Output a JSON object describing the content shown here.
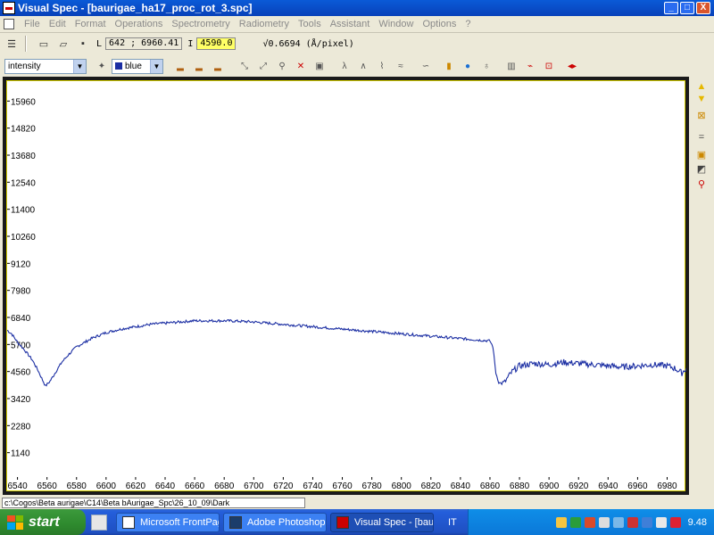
{
  "window": {
    "title": "Visual Spec - [baurigae_ha17_proc_rot_3.spc]",
    "min": "_",
    "max": "□",
    "close": "X"
  },
  "menu": [
    "File",
    "Edit",
    "Format",
    "Operations",
    "Spectrometry",
    "Radiometry",
    "Tools",
    "Assistant",
    "Window",
    "Options",
    "?"
  ],
  "toolbar1": {
    "l_label": "L",
    "coords": "642 ; 6960.41",
    "i_label": "I",
    "intensity": "4590.0",
    "dispersion": "√0.6694 (Å/pixel)"
  },
  "toolbar2": {
    "profile_select": "intensity",
    "color_select": "blue"
  },
  "status": {
    "path": "c:\\Cogos\\Beta aurigae\\C14\\Beta bAurigae_Spc\\26_10_09\\Dark"
  },
  "taskbar": {
    "start": "start",
    "tasks": [
      "Microsoft FrontPage -...",
      "Adobe Photoshop CS3",
      "Visual Spec - [bauriga..."
    ],
    "lang": "IT",
    "clock": "9.48"
  },
  "colors": {
    "plot_line": "#1b2ea3",
    "plot_bg": "#ffffff",
    "plot_border": "#d7d000"
  },
  "chart_data": {
    "type": "line",
    "x_ticks": [
      6540,
      6560,
      6580,
      6600,
      6620,
      6640,
      6660,
      6680,
      6700,
      6720,
      6740,
      6760,
      6780,
      6800,
      6820,
      6840,
      6860,
      6880,
      6900,
      6920,
      6940,
      6960,
      6980
    ],
    "y_ticks": [
      1140,
      2280,
      3420,
      4560,
      5700,
      6840,
      7980,
      9120,
      10260,
      11400,
      12540,
      13680,
      14820,
      15960
    ],
    "xlim": [
      6533,
      6993
    ],
    "ylim": [
      0,
      16800
    ],
    "series": [
      {
        "x": [
          6533,
          6536,
          6540,
          6545,
          6550,
          6554,
          6557,
          6559,
          6562,
          6566,
          6570,
          6575,
          6580,
          6590,
          6600,
          6610,
          6620,
          6630,
          6640,
          6650,
          6660,
          6670,
          6680,
          6690,
          6700,
          6710,
          6720,
          6730,
          6740,
          6750,
          6760,
          6770,
          6780,
          6790,
          6800,
          6810,
          6820,
          6830,
          6840,
          6850,
          6860,
          6862,
          6864,
          6866,
          6868,
          6870,
          6872,
          6875,
          6880,
          6890,
          6900,
          6910,
          6920,
          6930,
          6940,
          6950,
          6960,
          6970,
          6980,
          6985,
          6990,
          6993
        ],
        "y": [
          6300,
          6150,
          5800,
          5450,
          5050,
          4600,
          4200,
          3950,
          4150,
          4550,
          4950,
          5300,
          5600,
          5950,
          6200,
          6350,
          6450,
          6550,
          6600,
          6650,
          6700,
          6700,
          6700,
          6680,
          6650,
          6600,
          6550,
          6500,
          6450,
          6400,
          6350,
          6300,
          6250,
          6200,
          6150,
          6100,
          6050,
          6000,
          5950,
          5900,
          5850,
          5600,
          4500,
          4100,
          4050,
          4100,
          4300,
          4550,
          4800,
          4900,
          4850,
          4950,
          4900,
          4850,
          4800,
          4750,
          4800,
          4850,
          4800,
          4700,
          4500,
          4700
        ]
      }
    ]
  }
}
